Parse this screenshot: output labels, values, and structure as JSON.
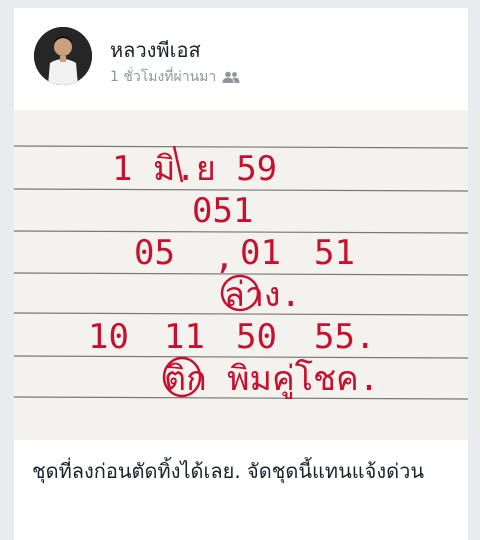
{
  "post": {
    "author": "หลวงพีเอส",
    "timestamp": "1 ชั่วโมงที่ผ่านมา",
    "privacy_icon": "friends-icon",
    "caption": "ชุดที่ลงก่อนตัดทิ้งได้เลย. จัดชุดนี้แทนแจ้งด่วน"
  },
  "photo": {
    "line1": "1 มิ.ย 59",
    "line2": "051",
    "line3": [
      "05",
      ",",
      "01",
      "51"
    ],
    "line4": "ล่าง.",
    "line5": [
      "10",
      "11",
      "50",
      "55."
    ],
    "line6": "ติก พิมคู่โชค."
  },
  "colors": {
    "ink": "#c8102e",
    "background": "#e9ebee",
    "card": "#ffffff",
    "meta_text": "#90949c",
    "notebook_line": "#7a7a7a"
  }
}
